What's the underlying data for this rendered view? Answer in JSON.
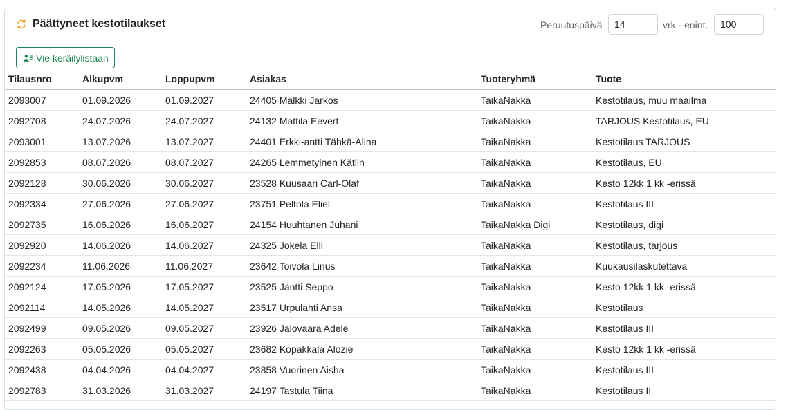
{
  "panel": {
    "title": "Päättyneet kestotilaukset",
    "icon": "refresh-icon",
    "accent_color": "#f0a020"
  },
  "controls": {
    "cancel_days_label": "Peruutuspäivä",
    "cancel_days_value": "14",
    "max_label": "vrk · enint.",
    "max_value": "100"
  },
  "actions": {
    "collect_label": "Vie keräilylistaan",
    "collect_icon": "user-list-icon",
    "collect_color": "#198754"
  },
  "table": {
    "columns": [
      "Tilausnro",
      "Alkupvm",
      "Loppupvm",
      "Asiakas",
      "Tuoteryhmä",
      "Tuote"
    ],
    "rows": [
      [
        "2093007",
        "01.09.2026",
        "01.09.2027",
        "24405 Malkki Jarkos",
        "TaikaNakka",
        "Kestotilaus, muu maailma"
      ],
      [
        "2092708",
        "24.07.2026",
        "24.07.2027",
        "24132 Mattila Eevert",
        "TaikaNakka",
        "TARJOUS Kestotilaus, EU"
      ],
      [
        "2093001",
        "13.07.2026",
        "13.07.2027",
        "24401 Erkki-antti Tähkä-Alina",
        "TaikaNakka",
        "Kestotilaus TARJOUS"
      ],
      [
        "2092853",
        "08.07.2026",
        "08.07.2027",
        "24265 Lemmetyinen Kätlin",
        "TaikaNakka",
        "Kestotilaus, EU"
      ],
      [
        "2092128",
        "30.06.2026",
        "30.06.2027",
        "23528 Kuusaari Carl-Olaf",
        "TaikaNakka",
        "Kesto 12kk 1 kk -erissä"
      ],
      [
        "2092334",
        "27.06.2026",
        "27.06.2027",
        "23751 Peltola Eliel",
        "TaikaNakka",
        "Kestotilaus III"
      ],
      [
        "2092735",
        "16.06.2026",
        "16.06.2027",
        "24154 Huuhtanen Juhani",
        "TaikaNakka Digi",
        "Kestotilaus, digi"
      ],
      [
        "2092920",
        "14.06.2026",
        "14.06.2027",
        "24325 Jokela Elli",
        "TaikaNakka",
        "Kestotilaus, tarjous"
      ],
      [
        "2092234",
        "11.06.2026",
        "11.06.2027",
        "23642 Toivola Linus",
        "TaikaNakka",
        "Kuukausilaskutettava"
      ],
      [
        "2092124",
        "17.05.2026",
        "17.05.2027",
        "23525 Jäntti Seppo",
        "TaikaNakka",
        "Kesto 12kk 1 kk -erissä"
      ],
      [
        "2092114",
        "14.05.2026",
        "14.05.2027",
        "23517 Urpulahti Ansa",
        "TaikaNakka",
        "Kestotilaus"
      ],
      [
        "2092499",
        "09.05.2026",
        "09.05.2027",
        "23926 Jalovaara Adele",
        "TaikaNakka",
        "Kestotilaus III"
      ],
      [
        "2092263",
        "05.05.2026",
        "05.05.2027",
        "23682 Kopakkala Alozie",
        "TaikaNakka",
        "Kesto 12kk 1 kk -erissä"
      ],
      [
        "2092438",
        "04.04.2026",
        "04.04.2027",
        "23858 Vuorinen Aisha",
        "TaikaNakka",
        "Kestotilaus III"
      ],
      [
        "2092783",
        "31.03.2026",
        "31.03.2027",
        "24197 Tastula Tiina",
        "TaikaNakka",
        "Kestotilaus II"
      ]
    ]
  }
}
